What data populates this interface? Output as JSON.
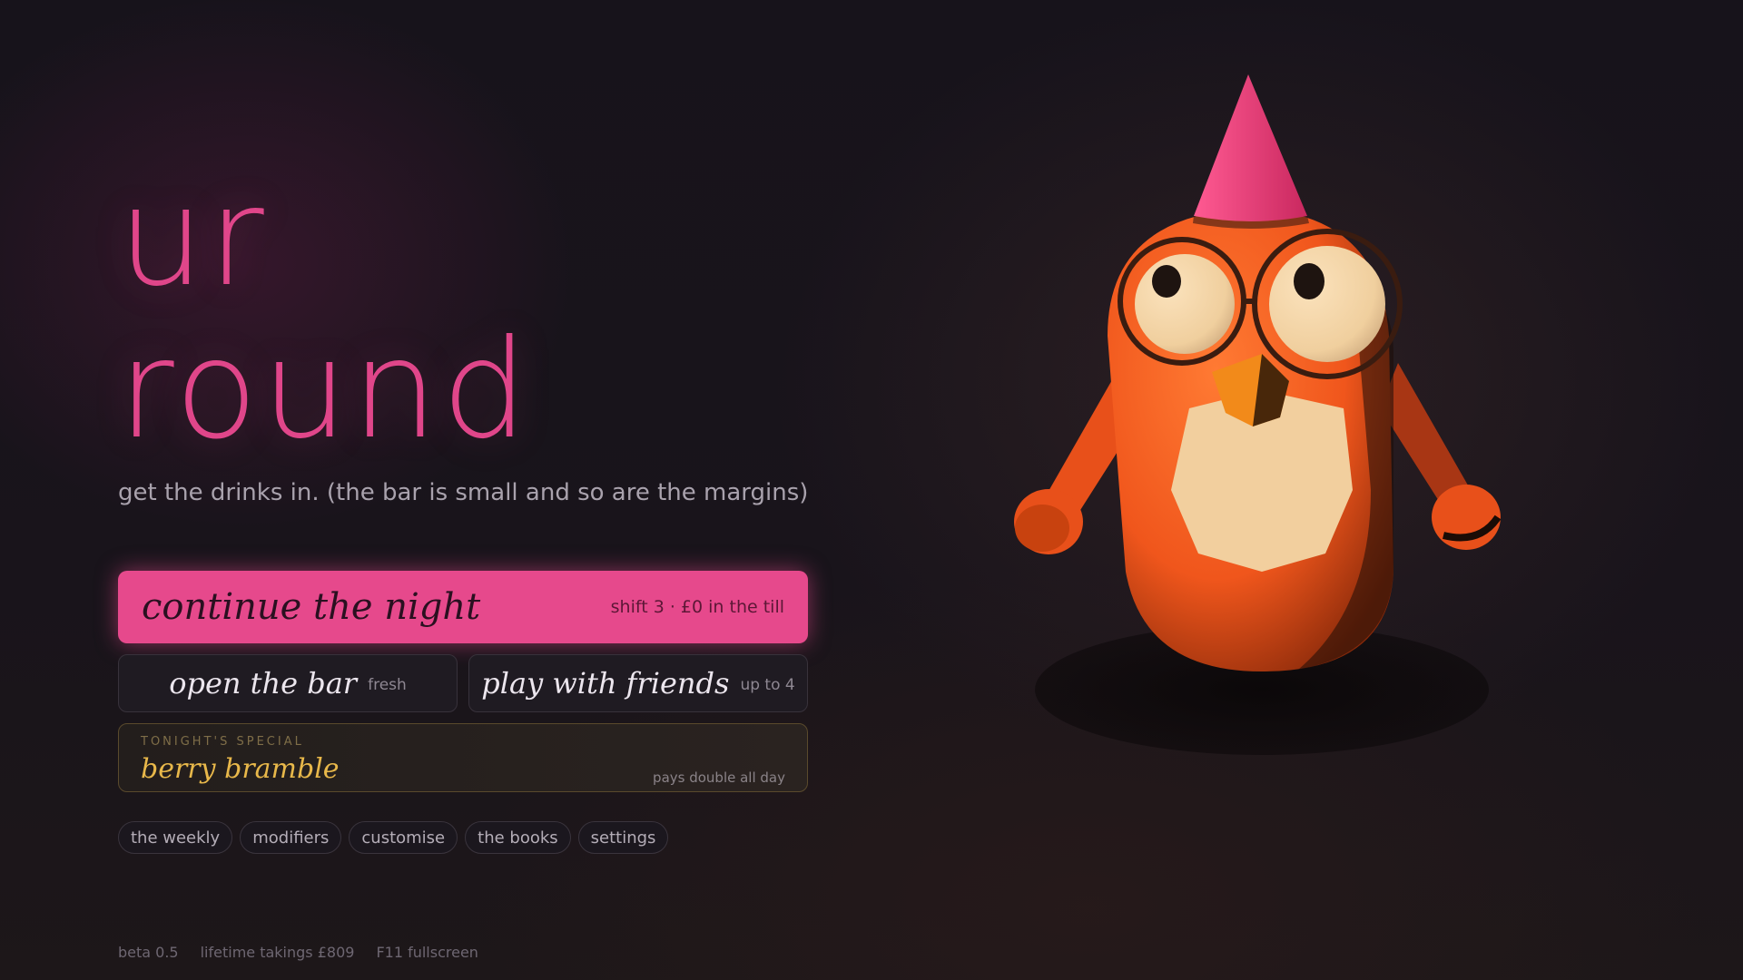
{
  "title": {
    "line1": "ur",
    "line2": "round"
  },
  "tagline": "get the drinks in. (the bar is small and so are the margins)",
  "primary_button": {
    "label": "continue the night",
    "meta": "shift 3 · £0 in the till"
  },
  "secondary_buttons": [
    {
      "label": "open the bar",
      "meta": "fresh"
    },
    {
      "label": "play with friends",
      "meta": "up to 4"
    }
  ],
  "special": {
    "kicker": "TONIGHT'S SPECIAL",
    "name": "berry bramble",
    "note": "pays double all day"
  },
  "chips": [
    {
      "label": "the weekly"
    },
    {
      "label": "modifiers"
    },
    {
      "label": "customise"
    },
    {
      "label": "the books"
    },
    {
      "label": "settings"
    }
  ],
  "footer": {
    "version": "beta 0.5",
    "takings": "lifetime takings £809",
    "fullscreen": "F11 fullscreen"
  },
  "colors": {
    "accent": "#e6498c",
    "special_gold": "#e8b84a",
    "background": "#16121a",
    "mascot_body": "#f0561c"
  }
}
